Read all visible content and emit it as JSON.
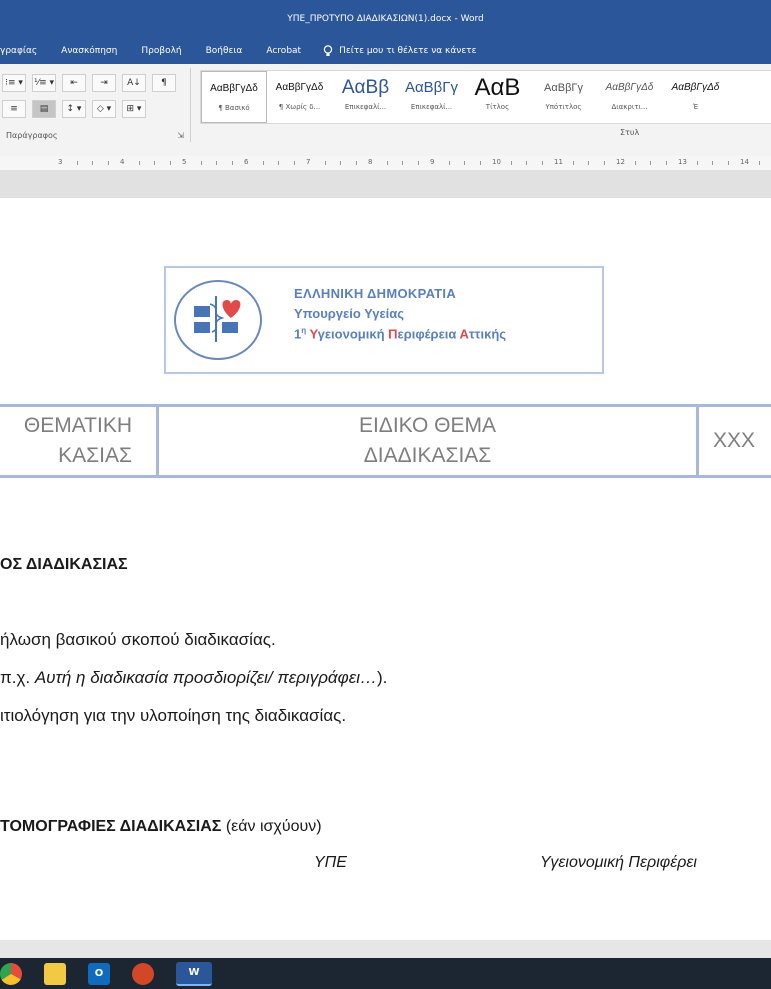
{
  "window": {
    "title": "ΥΠΕ_ΠΡΟΤΥΠΟ ΔΙΑΔΙΚΑΣΙΩΝ(1).docx  -  Word"
  },
  "menu": {
    "tabs": [
      "γραφίας",
      "Ανασκόπηση",
      "Προβολή",
      "Βοήθεια",
      "Acrobat"
    ],
    "tell_me": "Πείτε μου τι θέλετε να κάνετε"
  },
  "ribbon": {
    "paragraph_label": "Παράγραφος",
    "paragraph_tools_row1": [
      "⁝≡ ▾",
      "⅟≡ ▾",
      "⇤",
      "⇥",
      "A↓",
      "¶"
    ],
    "paragraph_tools_row2": [
      "≡",
      "▤",
      "↕ ▾",
      "◇ ▾",
      "⊞ ▾"
    ],
    "styles_label": "Στυλ",
    "styles": [
      {
        "preview": "ΑαΒβΓγΔδ",
        "name": "¶ Βασικό"
      },
      {
        "preview": "ΑαΒβΓγΔδ",
        "name": "¶ Χωρίς δ..."
      },
      {
        "preview": "ΑαΒβ",
        "name": "Επικεφαλί..."
      },
      {
        "preview": "ΑαΒβΓγ",
        "name": "Επικεφαλί..."
      },
      {
        "preview": "ΑαΒ",
        "name": "Τίτλος"
      },
      {
        "preview": "ΑαΒβΓγ",
        "name": "Υπότιτλος"
      },
      {
        "preview": "ΑαΒβΓγΔδ",
        "name": "Διακριτι..."
      },
      {
        "preview": "ΑαΒβΓγΔδ",
        "name": "Έ"
      }
    ]
  },
  "ruler": {
    "numbers": [
      "3",
      "4",
      "5",
      "6",
      "7",
      "8",
      "9",
      "10",
      "11",
      "12",
      "13",
      "14"
    ]
  },
  "document": {
    "logo": {
      "line1": "ΕΛΛΗΝΙΚΗ ΔΗΜΟΚΡΑΤΙΑ",
      "line2": "Υπουργείο Υγείας",
      "line3_prefix": "1",
      "line3_sup": "η",
      "line3_y": "Υ",
      "line3_a": "γειονομική ",
      "line3_p": "Π",
      "line3_b": "εριφέρεια ",
      "line3_at": "Α",
      "line3_c": "ττικής"
    },
    "header_table": {
      "cell1_line1": "ΘΕΜΑΤΙΚΗ",
      "cell1_line2": "ΚΑΣΙΑΣ",
      "cell2_line1": "ΕΙΔΙΚΟ ΘΕΜΑ",
      "cell2_line2": "ΔΙΑΔΙΚΑΣΙΑΣ",
      "cell3": "XXX"
    },
    "purpose_title": "ΟΣ ΔΙΑΔΙΚΑΣΙΑΣ",
    "line1": "ήλωση βασικού σκοπού διαδικασίας.",
    "line2_prefix": "π.χ. ",
    "line2_italic": "Αυτή η διαδικασία προσδιορίζει/ περιγράφει…",
    "line2_suffix": ").",
    "line3": "ιτιολόγηση για την υλοποίηση της διαδικασίας.",
    "orgs_title_bold": "ΤΟΜΟΓΡΑΦΙΕΣ ΔΙΑΔΙΚΑΣΙΑΣ",
    "orgs_title_rest": " (εάν ισχύουν)",
    "col_ype": "ΥΠΕ",
    "col_region": "Υγειονομική Περιφέρει"
  },
  "taskbar": {
    "icons": [
      "chrome-icon",
      "file-explorer-icon",
      "outlook-icon",
      "powerpoint-icon",
      "word-icon"
    ],
    "word_letter": "W",
    "outlook_letter": "O"
  }
}
